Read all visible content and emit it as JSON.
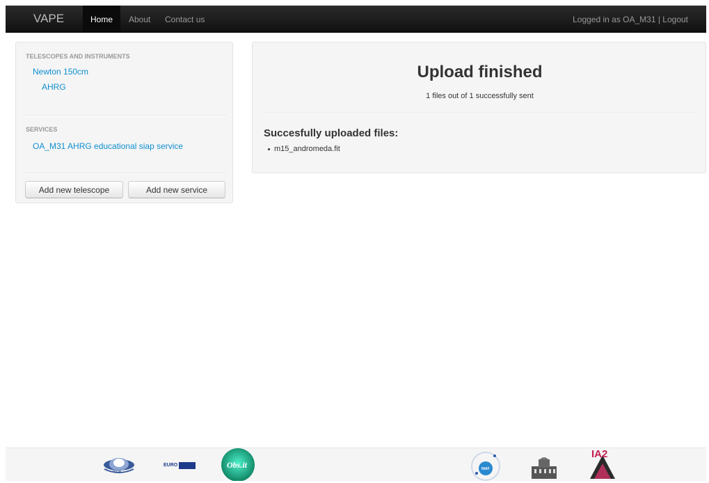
{
  "navbar": {
    "brand": "VAPE",
    "items": [
      {
        "label": "Home"
      },
      {
        "label": "About"
      },
      {
        "label": "Contact us"
      }
    ],
    "user_status": "Logged in as OA_M31 | Logout"
  },
  "sidebar": {
    "telescopes_header": "TELESCOPES AND INSTRUMENTS",
    "telescope": "Newton 150cm",
    "instrument": "AHRG",
    "services_header": "SERVICES",
    "service": "OA_M31 AHRG educational siap service",
    "add_telescope_label": "Add new telescope",
    "add_service_label": "Add new service"
  },
  "main": {
    "title": "Upload finished",
    "subtitle": "1 files out of 1 successfully sent",
    "files_heading": "Succesfully uploaded files:",
    "files": [
      "m15_andromeda.fit"
    ]
  },
  "footer": {
    "logos": [
      {
        "name": "ivoa",
        "label": "IVOA"
      },
      {
        "name": "eurovo",
        "label": "EURO VO"
      },
      {
        "name": "obs-it",
        "label": "Obs.it"
      },
      {
        "name": "inaf",
        "label": "INAF"
      },
      {
        "name": "observatory-building",
        "label": ""
      },
      {
        "name": "ia2",
        "label": "IA2"
      }
    ]
  }
}
